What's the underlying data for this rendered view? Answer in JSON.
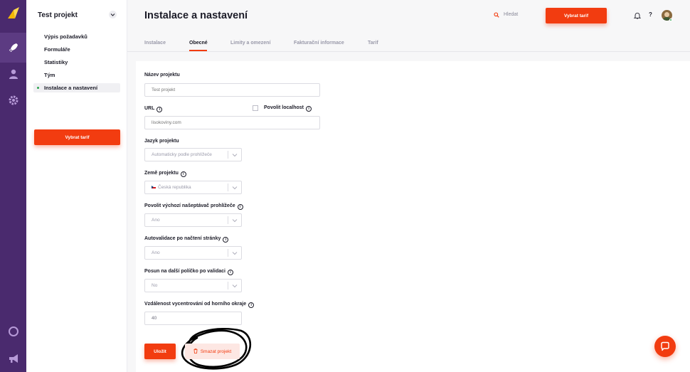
{
  "rail": {
    "icons": [
      "logo-icon",
      "rocket-icon",
      "user-icon",
      "gear-icon",
      "ring-icon",
      "megaphone-icon"
    ]
  },
  "sidebar": {
    "project_name": "Test projekt",
    "items": [
      {
        "label": "Výpis požadavků"
      },
      {
        "label": "Formuláře"
      },
      {
        "label": "Statistiky"
      },
      {
        "label": "Tým"
      },
      {
        "label": "Instalace a nastavení",
        "active": true
      }
    ],
    "cta_label": "Vybrat tarif"
  },
  "header": {
    "title": "Instalace a nastavení",
    "search_label": "Hledat",
    "cta_label": "Vybrat tarif",
    "help_label": "?"
  },
  "tabs": [
    {
      "label": "Instalace"
    },
    {
      "label": "Obecné",
      "active": true
    },
    {
      "label": "Limity a omezení"
    },
    {
      "label": "Fakturační informace"
    },
    {
      "label": "Tarif"
    }
  ],
  "form": {
    "project_name_label": "Název projektu",
    "project_name_placeholder": "Test projekt",
    "url_label": "URL",
    "localhost_label": "Povolit localhost",
    "url_placeholder": "lisokoviny.com",
    "language_label": "Jazyk projektu",
    "language_value": "Automaticky podle prohlížeče",
    "country_label": "Země projektu",
    "country_value": "Česká republika",
    "autocomplete_label": "Povolit výchozí našeptávač prohlížeče",
    "autocomplete_value": "Ano",
    "autovalidate_label": "Autovalidace po načtení stránky",
    "autovalidate_value": "Ano",
    "advance_label": "Posun na další políčko po validaci",
    "advance_value": "No",
    "offset_label": "Vzdálenost vycentrování od horního okraje",
    "offset_value": "40",
    "save_label": "Uložit",
    "delete_label": "Smazat projekt"
  },
  "colors": {
    "accent": "#f23c10",
    "rail": "#4a2a6e",
    "status_green": "#2ea44f"
  }
}
